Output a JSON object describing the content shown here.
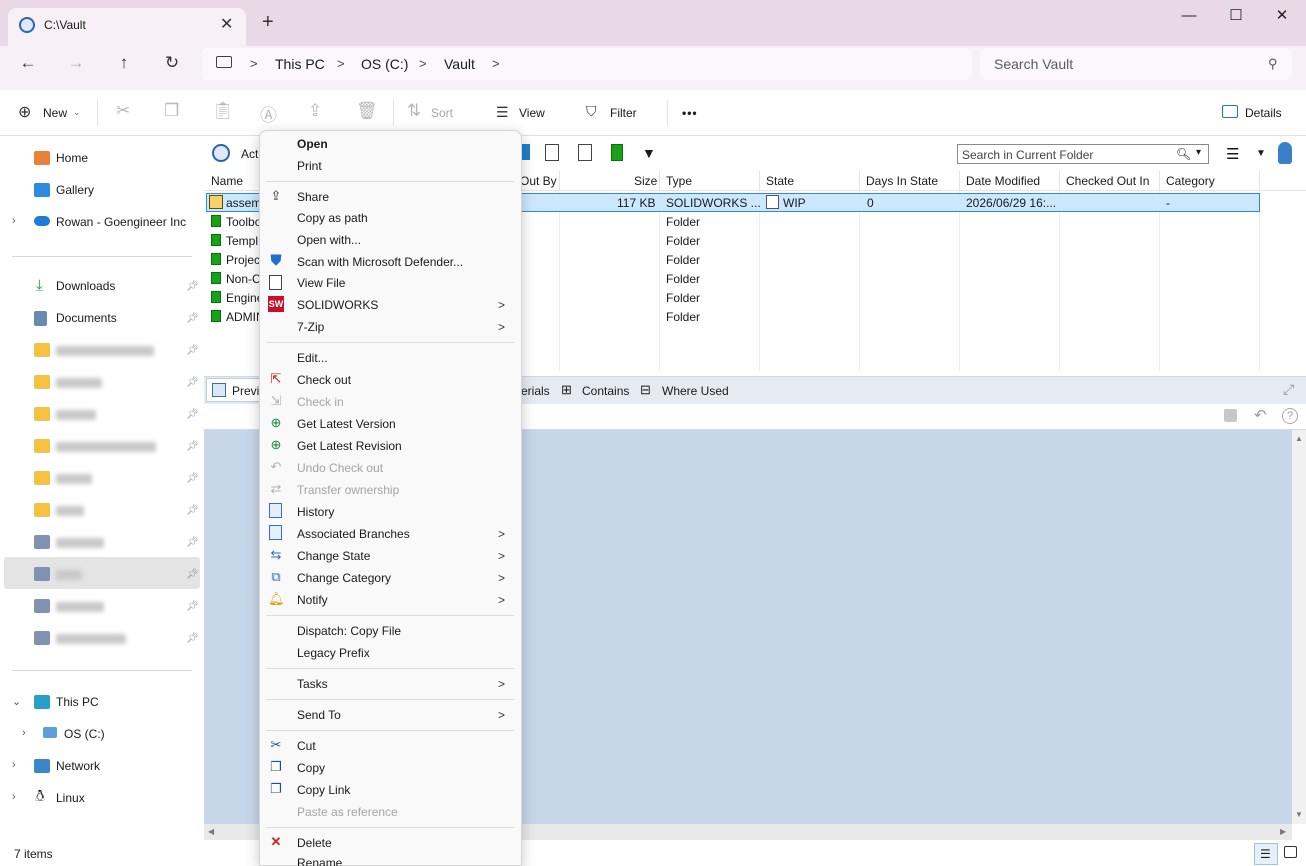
{
  "window": {
    "tab_title": "C:\\Vault",
    "tab_close": "✕",
    "new_tab": "+",
    "minimize": "—",
    "maximize": "☐",
    "close": "✕"
  },
  "nav": {
    "back": "←",
    "forward": "→",
    "up": "↑",
    "refresh": "↻",
    "breadcrumbs": [
      "This PC",
      "OS (C:)",
      "Vault"
    ],
    "chevron": ">",
    "search_placeholder": "Search Vault",
    "search_icon": "⚲"
  },
  "commandbar": {
    "new_label": "New",
    "sort_label": "Sort",
    "view_label": "View",
    "filter_label": "Filter",
    "more_label": "•••",
    "details_label": "Details"
  },
  "sidebar": {
    "items": [
      {
        "label": "Home",
        "icon": "home-icon"
      },
      {
        "label": "Gallery",
        "icon": "gallery-icon"
      },
      {
        "label": "Rowan - Goengineer Inc",
        "icon": "cloud-icon"
      }
    ],
    "pinned": [
      {
        "label": "Downloads",
        "icon": "download-icon"
      },
      {
        "label": "Documents",
        "icon": "documents-icon"
      }
    ],
    "tree": [
      {
        "label": "This PC",
        "icon": "computer-icon"
      },
      {
        "label": "OS (C:)",
        "icon": "drive-icon"
      },
      {
        "label": "Network",
        "icon": "network-icon"
      },
      {
        "label": "Linux",
        "icon": "linux-icon"
      }
    ]
  },
  "vault": {
    "action_label": "Act",
    "search_current_placeholder": "Search in Current Folder",
    "columns": {
      "name": "Name",
      "out_by": "Out By",
      "size": "Size",
      "type": "Type",
      "state": "State",
      "days": "Days In State",
      "date": "Date Modified",
      "checked_out_in": "Checked Out In",
      "category": "Category"
    },
    "selected_row": {
      "name": "assem",
      "size": "117 KB",
      "type": "SOLIDWORKS ...",
      "state": "WIP",
      "days": "0",
      "date": "2026/06/29 16:...",
      "category": "-"
    },
    "folder_rows": [
      {
        "name": "Toolbo",
        "type": "Folder"
      },
      {
        "name": "Templ",
        "type": "Folder"
      },
      {
        "name": "Projec",
        "type": "Folder"
      },
      {
        "name": "Non-C",
        "type": "Folder"
      },
      {
        "name": "Engine",
        "type": "Folder"
      },
      {
        "name": "ADMIN",
        "type": "Folder"
      }
    ],
    "lower_tabs": {
      "preview": "Previ",
      "materials": "erials",
      "contains": "Contains",
      "where_used": "Where Used"
    }
  },
  "status": {
    "items_count": "7 items"
  },
  "context_menu": {
    "items": [
      {
        "label": "Open",
        "bold": true
      },
      {
        "label": "Print"
      },
      {
        "label": "Share",
        "icon": "share-icon"
      },
      {
        "label": "Copy as path"
      },
      {
        "label": "Open with..."
      },
      {
        "label": "Scan with Microsoft Defender...",
        "icon": "defender-icon"
      },
      {
        "label": "View File",
        "icon": "view-file-icon"
      },
      {
        "label": "SOLIDWORKS",
        "icon": "solidworks-icon",
        "submenu": true
      },
      {
        "label": "7-Zip",
        "submenu": true
      },
      {
        "label": "Edit..."
      },
      {
        "label": "Check out",
        "icon": "check-out-icon"
      },
      {
        "label": "Check in",
        "disabled": true,
        "icon": "check-in-icon"
      },
      {
        "label": "Get Latest Version",
        "icon": "get-latest-version-icon"
      },
      {
        "label": "Get Latest Revision",
        "icon": "get-latest-revision-icon"
      },
      {
        "label": "Undo Check out",
        "disabled": true,
        "icon": "undo-icon"
      },
      {
        "label": "Transfer ownership",
        "disabled": true,
        "icon": "transfer-icon"
      },
      {
        "label": "History",
        "icon": "history-icon"
      },
      {
        "label": "Associated Branches",
        "icon": "branches-icon",
        "submenu": true
      },
      {
        "label": "Change State",
        "icon": "change-state-icon",
        "submenu": true
      },
      {
        "label": "Change Category",
        "icon": "change-category-icon",
        "submenu": true
      },
      {
        "label": "Notify",
        "icon": "bell-icon",
        "submenu": true
      },
      {
        "label": "Dispatch: Copy File"
      },
      {
        "label": "Legacy Prefix"
      },
      {
        "label": "Tasks",
        "submenu": true
      },
      {
        "label": "Send To",
        "submenu": true
      },
      {
        "label": "Cut",
        "icon": "scissors-icon"
      },
      {
        "label": "Copy",
        "icon": "copy-icon"
      },
      {
        "label": "Copy Link",
        "icon": "copy-link-icon"
      },
      {
        "label": "Paste as reference",
        "disabled": true
      },
      {
        "label": "Delete",
        "icon": "delete-icon"
      },
      {
        "label": "Rename"
      }
    ],
    "submenu_arrow": ">"
  },
  "colors": {
    "titlebar": "#e9d9e6",
    "selection": "#cce8ff",
    "preview_bg": "#c7d6e9",
    "folder_green": "#17a317",
    "delete_red": "#d02020"
  }
}
